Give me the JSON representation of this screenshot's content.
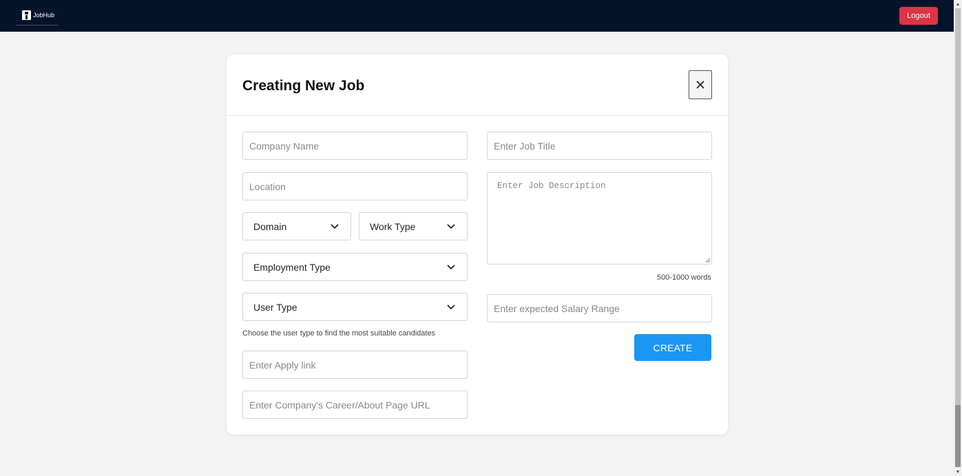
{
  "navbar": {
    "brand_text": "JobHub",
    "logout_label": "Logout"
  },
  "modal": {
    "title": "Creating New Job",
    "close_symbol": "✕"
  },
  "form": {
    "company_name_placeholder": "Company Name",
    "location_placeholder": "Location",
    "domain_label": "Domain",
    "work_type_label": "Work Type",
    "employment_type_label": "Employment Type",
    "user_type_label": "User Type",
    "user_type_hint": "Choose the user type to find the most suitable candidates",
    "apply_link_placeholder": "Enter Apply link",
    "career_url_placeholder": "Enter Company's Career/About Page URL",
    "job_title_placeholder": "Enter Job Title",
    "job_description_placeholder": "Enter Job Description",
    "description_word_hint": "500-1000 words",
    "salary_placeholder": "Enter expected Salary Range",
    "create_label": "CREATE"
  },
  "icons": {
    "brand": "briefcase-person-icon",
    "close": "close-icon",
    "dropdown": "chevron-down-icon"
  },
  "colors": {
    "navbar_bg": "#03132a",
    "logout_bg": "#dc3545",
    "create_bg": "#1c96f3",
    "page_bg": "#f3f3f4"
  }
}
